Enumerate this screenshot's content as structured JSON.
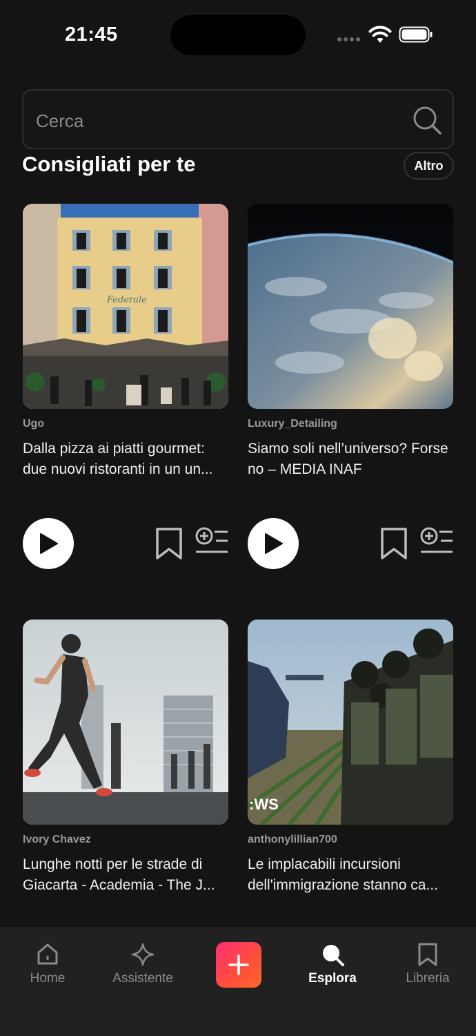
{
  "status_bar": {
    "time": "21:45"
  },
  "search": {
    "placeholder": "Cerca"
  },
  "section": {
    "title": "Consigliati per te",
    "more_label": "Altro"
  },
  "cards": [
    {
      "author": "Ugo",
      "title": "Dalla pizza ai piatti gourmet: due nuovi ristoranti in un un..."
    },
    {
      "author": "Luxury_Detailing",
      "title": "Siamo soli nell’universo? Forse no – MEDIA INAF"
    },
    {
      "author": "Ivory Chavez",
      "title": "Lunghe notti per le strade di Giacarta - Academia - The J..."
    },
    {
      "author": "anthonylillian700",
      "title": "Le implacabili incursioni dell'immigrazione stanno ca...",
      "thumb_overlay": ":WS"
    }
  ],
  "tabbar": {
    "items": [
      {
        "label": "Home",
        "icon": "home-icon",
        "active": false
      },
      {
        "label": "Assistente",
        "icon": "sparkle-icon",
        "active": false
      },
      {
        "label": "",
        "icon": "plus-icon",
        "active": false
      },
      {
        "label": "Esplora",
        "icon": "search-icon",
        "active": true
      },
      {
        "label": "Libreria",
        "icon": "bookmark-icon",
        "active": false
      }
    ]
  },
  "colors": {
    "background": "#141414",
    "tabbar": "#212121",
    "accent_gradient_start": "#ff2e72",
    "accent_gradient_end": "#ff6a2a"
  }
}
